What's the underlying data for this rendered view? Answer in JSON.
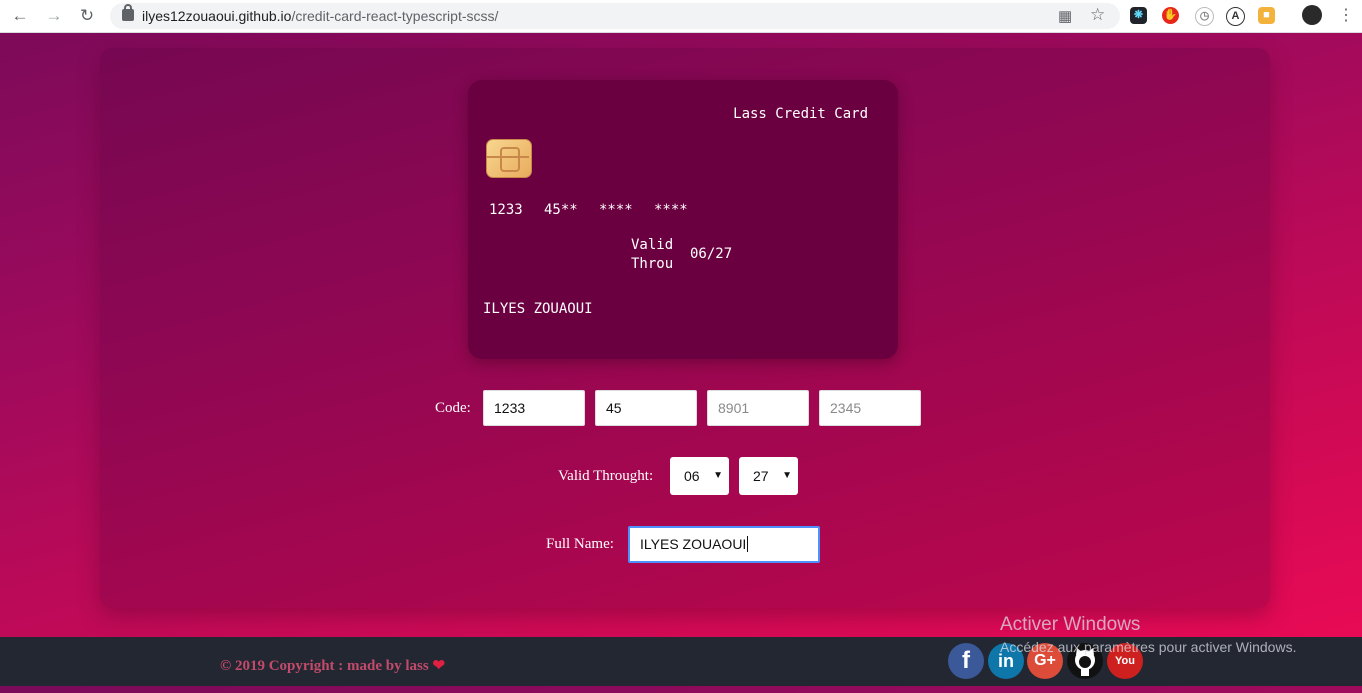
{
  "browser": {
    "url_host": "ilyes12zouaoui.github.io",
    "url_path": "/credit-card-react-typescript-scss/"
  },
  "card": {
    "title": "Lass Credit Card",
    "number_groups": [
      "1233",
      "45**",
      "****",
      "****"
    ],
    "valid_label_line1": "Valid",
    "valid_label_line2": "Throu",
    "valid_date": "06/27",
    "holder": "ILYES ZOUAOUI"
  },
  "form": {
    "code_label": "Code:",
    "code_fields": [
      {
        "value": "1233",
        "placeholder": ""
      },
      {
        "value": "45",
        "placeholder": ""
      },
      {
        "value": "",
        "placeholder": "8901"
      },
      {
        "value": "",
        "placeholder": "2345"
      }
    ],
    "valid_label": "Valid Throught:",
    "month": "06",
    "year": "27",
    "name_label": "Full Name:",
    "name_value": "ILYES ZOUAOUI"
  },
  "footer": {
    "copyright": "© 2019 Copyright : made by lass",
    "social": [
      {
        "icon": "facebook-icon",
        "glyph": "f",
        "color": "#3b5998"
      },
      {
        "icon": "linkedin-icon",
        "glyph": "in",
        "color": "#0e76a8"
      },
      {
        "icon": "google-plus-icon",
        "glyph": "G+",
        "color": "#dd4b39"
      },
      {
        "icon": "github-icon",
        "glyph": "",
        "color": "#111111"
      },
      {
        "icon": "youtube-icon",
        "glyph": "You",
        "color": "#cd201f"
      }
    ]
  },
  "watermark": {
    "line1": "Activer Windows",
    "line2": "Accédez aux paramètres pour activer Windows."
  }
}
